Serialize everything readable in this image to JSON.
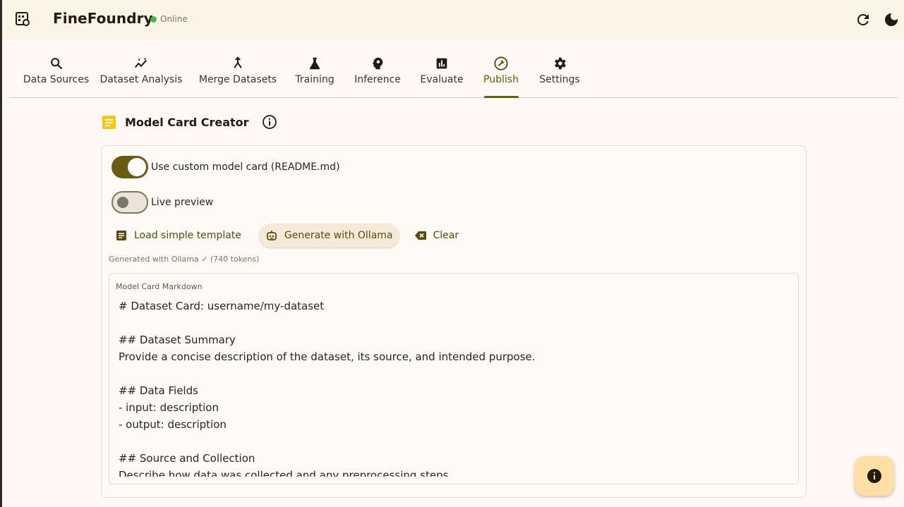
{
  "app": {
    "title": "FineFoundry",
    "status": "Online",
    "status_color": "#4caf50",
    "accent": "#6b5a12"
  },
  "tabs": [
    {
      "label": "Data Sources",
      "icon": "search-icon",
      "active": false
    },
    {
      "label": "Dataset Analysis",
      "icon": "insights-icon",
      "active": false
    },
    {
      "label": "Merge Datasets",
      "icon": "merge-icon",
      "active": false
    },
    {
      "label": "Training",
      "icon": "flask-icon",
      "active": false
    },
    {
      "label": "Inference",
      "icon": "psychology-icon",
      "active": false
    },
    {
      "label": "Evaluate",
      "icon": "bar-chart-icon",
      "active": false
    },
    {
      "label": "Publish",
      "icon": "build-icon",
      "active": true
    },
    {
      "label": "Settings",
      "icon": "gear-icon",
      "active": false
    }
  ],
  "section": {
    "title": "Model Card Creator"
  },
  "toggles": {
    "custom_card": {
      "label": "Use custom model card (README.md)",
      "on": true
    },
    "live_preview": {
      "label": "Live preview",
      "on": false
    }
  },
  "actions": {
    "load_template": "Load simple template",
    "generate": "Generate with Ollama",
    "clear": "Clear"
  },
  "generated_note": "Generated with Ollama ✓ (740 tokens)",
  "editor": {
    "label": "Model Card Markdown",
    "content": "# Dataset Card: username/my-dataset\n\n## Dataset Summary\nProvide a concise description of the dataset, its source, and intended purpose.\n\n## Data Fields\n- input: description\n- output: description\n\n## Source and Collection\nDescribe how data was collected and any preprocessing steps."
  }
}
